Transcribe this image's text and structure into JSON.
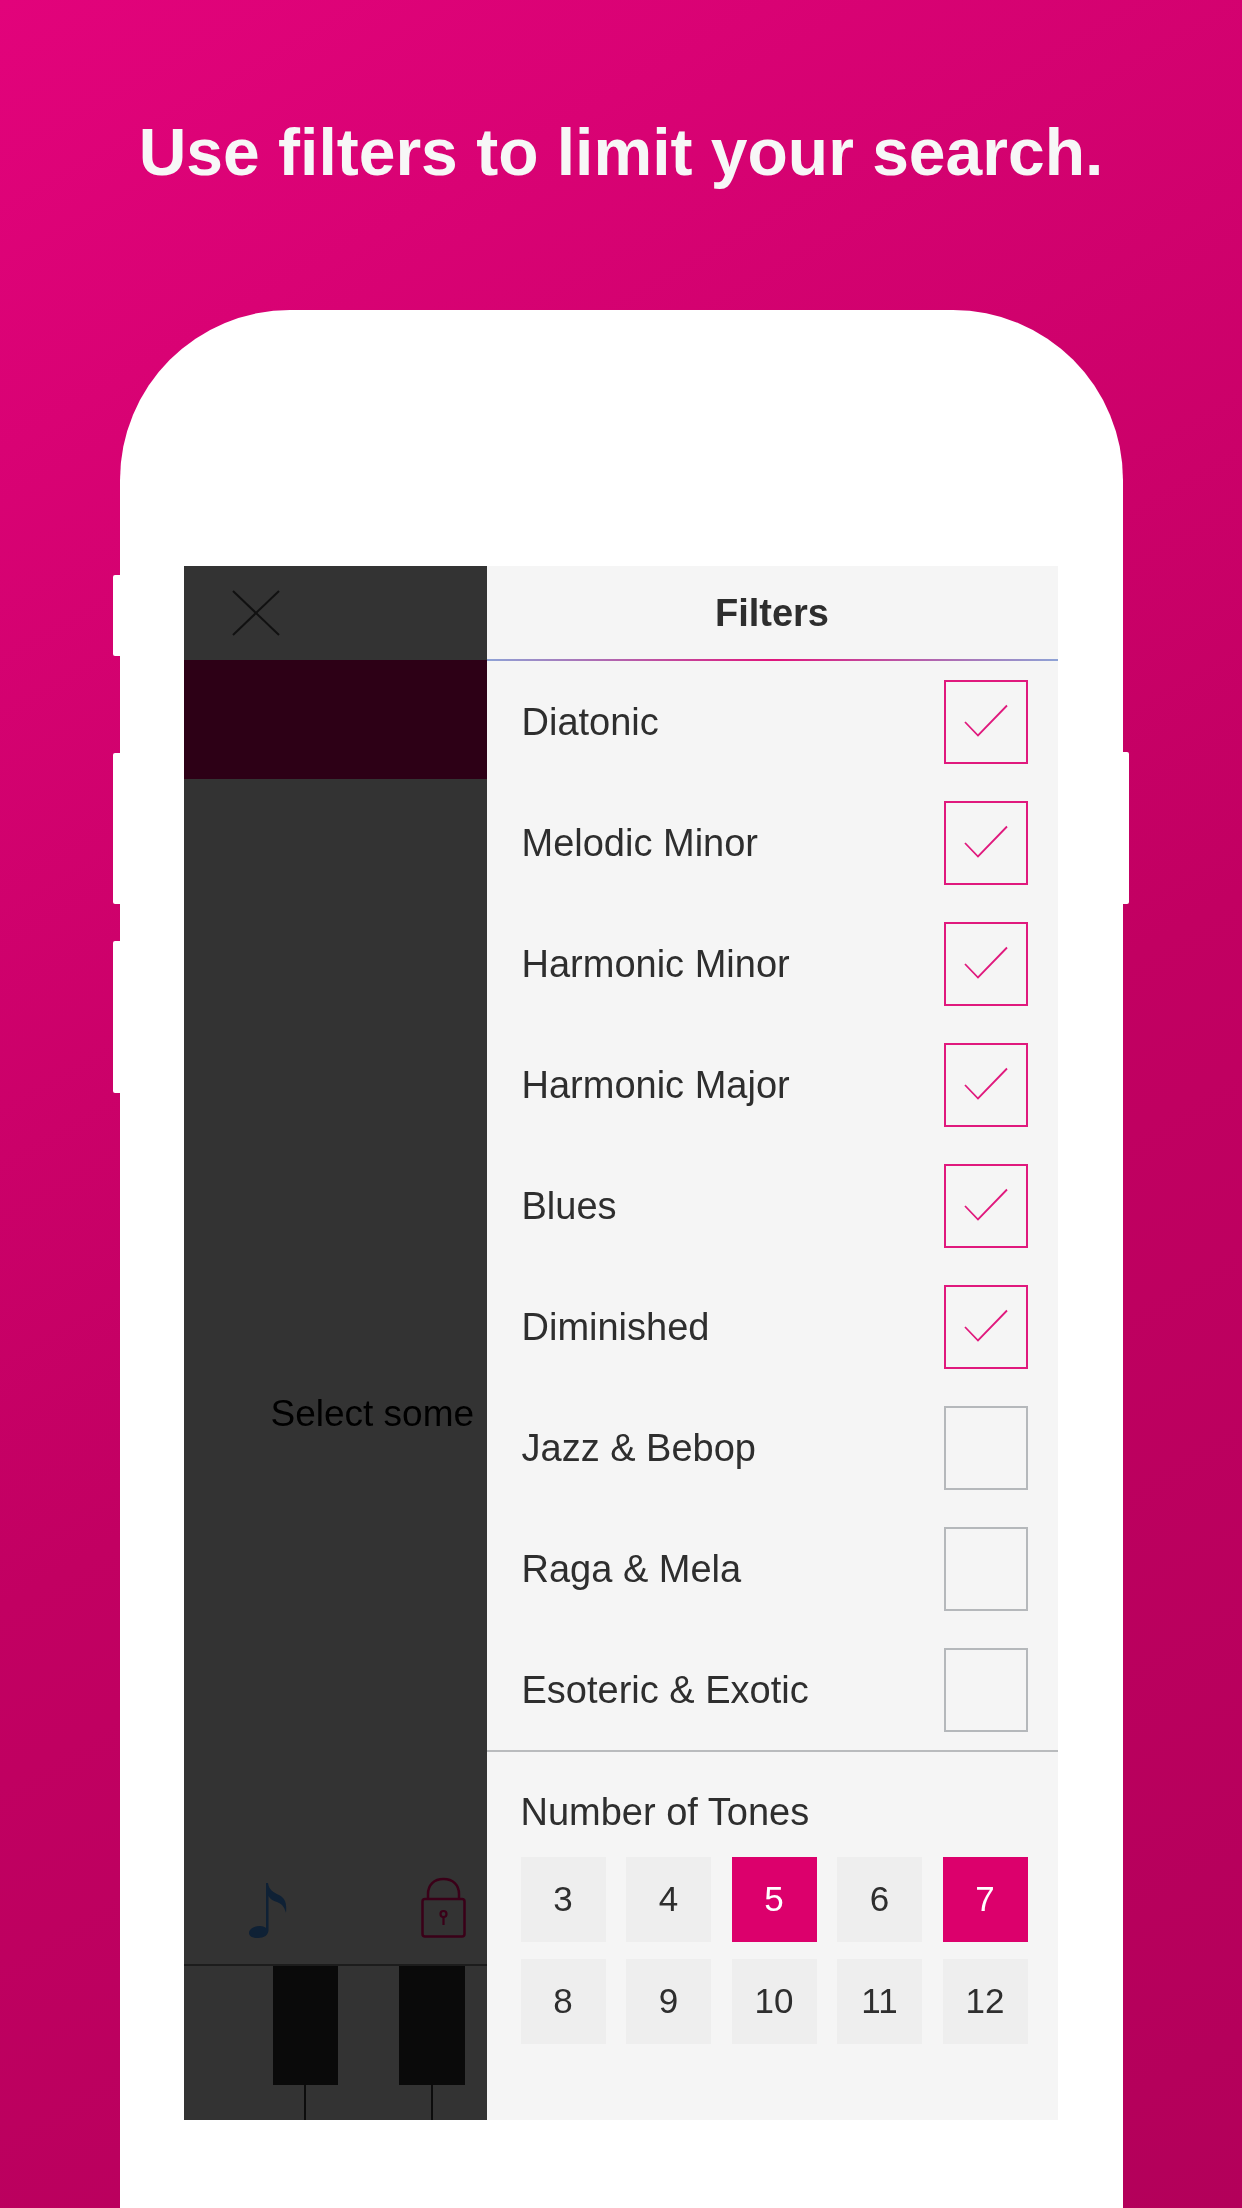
{
  "headline": "Use filters to limit your search.",
  "background_app": {
    "message": "Select some"
  },
  "filters": {
    "title": "Filters",
    "categories": [
      {
        "label": "Diatonic",
        "checked": true
      },
      {
        "label": "Melodic Minor",
        "checked": true
      },
      {
        "label": "Harmonic Minor",
        "checked": true
      },
      {
        "label": "Harmonic Major",
        "checked": true
      },
      {
        "label": "Blues",
        "checked": true
      },
      {
        "label": "Diminished",
        "checked": true
      },
      {
        "label": "Jazz & Bebop",
        "checked": false
      },
      {
        "label": "Raga & Mela",
        "checked": false
      },
      {
        "label": "Esoteric & Exotic",
        "checked": false
      }
    ],
    "tones": {
      "title": "Number of Tones",
      "options": [
        {
          "label": "3",
          "selected": false
        },
        {
          "label": "4",
          "selected": false
        },
        {
          "label": "5",
          "selected": true
        },
        {
          "label": "6",
          "selected": false
        },
        {
          "label": "7",
          "selected": true
        },
        {
          "label": "8",
          "selected": false
        },
        {
          "label": "9",
          "selected": false
        },
        {
          "label": "10",
          "selected": false
        },
        {
          "label": "11",
          "selected": false
        },
        {
          "label": "12",
          "selected": false
        }
      ]
    }
  }
}
